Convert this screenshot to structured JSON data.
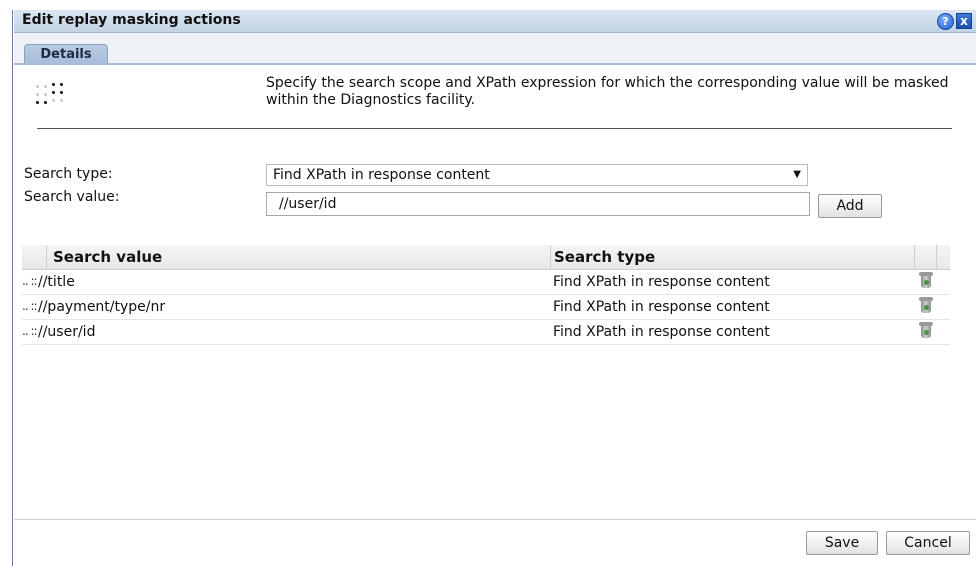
{
  "window": {
    "title": "Edit replay masking actions",
    "help_icon": "help-icon",
    "close_icon": "close-icon",
    "help_glyph": "?",
    "close_glyph": "x"
  },
  "tabs": [
    {
      "label": "Details",
      "active": true
    }
  ],
  "description": "Specify the search scope and XPath expression for which the corresponding value will be masked within the Diagnostics facility.",
  "form": {
    "search_type_label": "Search type:",
    "search_type_value": "Find XPath in response content",
    "search_value_label": "Search value:",
    "search_value_input": "//user/id",
    "add_label": "Add"
  },
  "table": {
    "columns": [
      "Search value",
      "Search type"
    ],
    "rows": [
      {
        "search_value": "//title",
        "search_type": "Find XPath in response content"
      },
      {
        "search_value": "//payment/type/nr",
        "search_type": "Find XPath in response content"
      },
      {
        "search_value": "//user/id",
        "search_type": "Find XPath in response content"
      }
    ]
  },
  "footer": {
    "save_label": "Save",
    "cancel_label": "Cancel"
  },
  "colors": {
    "titlebar": "#c3d3e6",
    "tab": "#a6bcd9",
    "accent": "#1c5fcf"
  }
}
